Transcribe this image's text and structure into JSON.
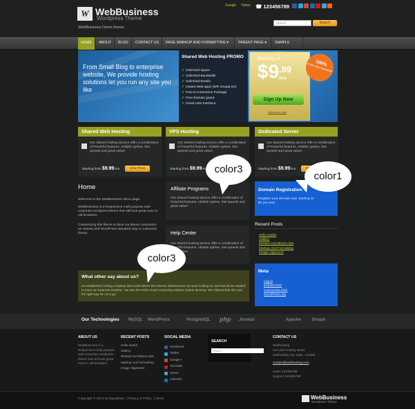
{
  "header": {
    "logo_mark": "W",
    "logo_title": "WebBusiness",
    "logo_subtitle": "Wordpress Theme",
    "demo_text": "WebBusiness Demo theme",
    "top_links": [
      "Google",
      "Yahoo"
    ],
    "phone": "☎ 123456789",
    "search_placeholder": "Search",
    "search_button": "Search",
    "social_colors": [
      "#3b5998",
      "#2aa9e0",
      "#d34836",
      "#0e76a8",
      "#cc181e",
      "#4aa2cf",
      "#ff6600"
    ]
  },
  "nav": {
    "items": [
      "HOME",
      "ABOUT",
      "BLOG",
      "CONTACT US",
      "PAGE MARKUP AND FORMATTING ▾",
      "PARENT PAGE ▾",
      "SAMPLE PAGE"
    ]
  },
  "hero": {
    "headline": "From Small Blog to enterprise website, We provide hosting solutions let you run any site you like",
    "promo_title": "Shared Web Hosting PROMO",
    "promo_items": [
      "Unlimited Space",
      "Unlimited Bandwidth",
      "Unlimited Emails",
      "Instant Web apps (WP, Drupal,etc)",
      "Free E-Commerce Package",
      "Free Domain guard",
      "Great User Interface"
    ],
    "starting_at": "Starting at",
    "price_dollar": "$9",
    "price_cents": ".99",
    "price_period": "/mo",
    "signup": "Sign Up Now",
    "view_plan": "view other plan",
    "badge_line1": "100%",
    "badge_line2": "money back guarantee"
  },
  "plans": [
    {
      "title": "Shared Web Hosting",
      "desc": "Our shared hosting service offer a combination of Powerful features, reliable uptime, fast speeds and great value!",
      "from": "Starting from",
      "price": "$9.99",
      "period": "/mo",
      "button": "View Plans"
    },
    {
      "title": "VPS Hosting",
      "desc": "Our shared hosting service offer a combination of Powerful features, reliable uptime, fast speeds and great value!",
      "from": "Starting from",
      "price": "$9.99",
      "period": "/mo",
      "button": "View Plans"
    },
    {
      "title": "Dedicated Server",
      "desc": "Our shared hosting service offer a combination of Powerful features, reliable uptime, fast speeds and great value!",
      "from": "Starting from",
      "price": "$9.99",
      "period": "/mo",
      "button": "View Plans"
    }
  ],
  "home": {
    "title": "Home",
    "p1": "Welcome to the WebBusiness demo page.",
    "p2": "WebBusiness is a Responsive multi purpose web corporate wordpress theme that still look great even in old browsers.",
    "p3": "Customizing this theme is done via theme customizer, an easiest and WordPress standard way to customize theme."
  },
  "affiliate": {
    "title": "Affiliate Programs",
    "desc": "Our shared hosting service offer a combination of Powerful features, reliable uptime, fast speeds and great value!"
  },
  "help": {
    "title": "Help Center",
    "desc": "Our shared hosting service offer a combination of Powerful features, reliable uptime, fast speeds and great value!"
  },
  "domain": {
    "title": "Domain Registration",
    "desc": "Register your domain now. Starting at $3 per year."
  },
  "recent": {
    "title": "Recent Posts",
    "items": [
      "Hello world!",
      "Gallery",
      "Nested And Mixed Lists",
      "Markup And Formatting",
      "Image Alignment"
    ]
  },
  "meta": {
    "title": "Meta",
    "items": [
      "Log in",
      "Entries RSS",
      "Comments RSS",
      "WordPress.org"
    ]
  },
  "testimonial": {
    "title": "What other say about us?",
    "text": "an established hosting company that could deliver the internet infrastructure we were looking for and had all we needed to meet our business timeline. \"we saw the entire cloud computing solution market develop. We realized that this was the right way for us to go.\""
  },
  "bubbles": [
    "color3",
    "color1",
    "color3"
  ],
  "tech": {
    "title": "Our Technologies",
    "items": [
      "MySQL",
      "WordPress",
      "PostgreSQL",
      "php",
      "Joomla!",
      "Apache",
      "Drupal"
    ]
  },
  "footer": {
    "about_h": "ABOUT US",
    "about_t": "WebBusiness is a Responsive multi purpose web corporate wordpress theme that still look great even in old browsers.",
    "recent_h": "RECENT POSTS",
    "recent_items": [
      "Hello world!",
      "Gallery",
      "Nested And Mixed Lists",
      "Markup And Formatting",
      "Image Alignment"
    ],
    "social_h": "SOCIAL MEDIA",
    "social_items": [
      "Facebook",
      "Twitter",
      "Google+",
      "YouTube",
      "Vimeo",
      "LinkedIn"
    ],
    "social_colors": [
      "#3b5998",
      "#2aa9e0",
      "#d34836",
      "#cc181e",
      "#4aa2cf",
      "#0e76a8"
    ],
    "search_h": "SEARCH",
    "search_placeholder": "Search",
    "contact_h": "CONTACT US",
    "contact_lines": [
      "Webhosting",
      "123 web hosting street",
      "webhosting city, state, 123456"
    ],
    "contact_email": "contact@webhosting.com",
    "contact_lines2": [
      "Sales 123456789",
      "Support 123456789"
    ]
  },
  "bottom": {
    "copyright": "Copyright © 2014 by BayuBayu",
    "links": [
      "Privacy & Policy",
      "About"
    ],
    "logo": "WebBusiness",
    "logo_sub": "Wordpress Theme"
  }
}
